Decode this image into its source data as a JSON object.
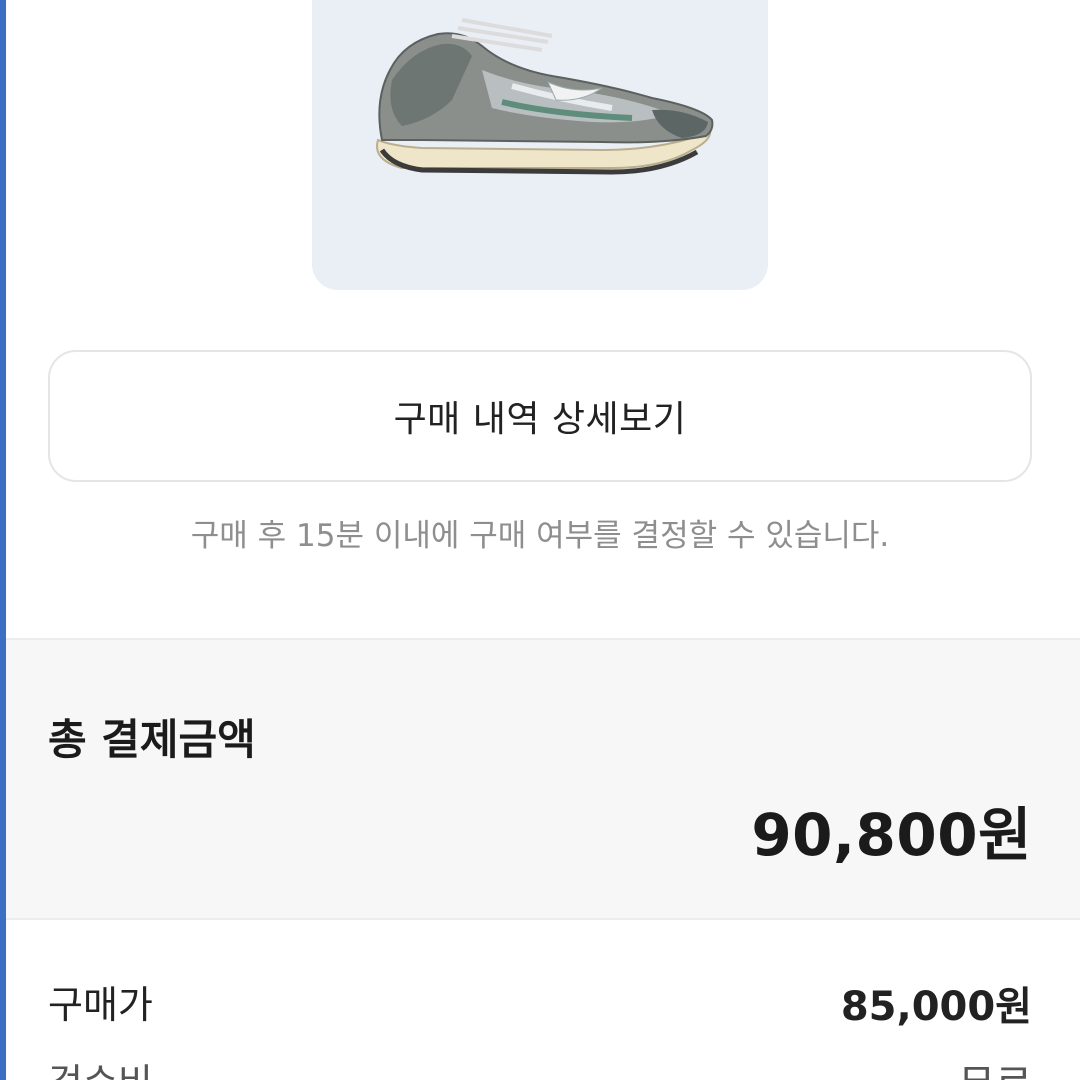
{
  "product": {
    "image_icon": "sneaker-image",
    "card_color": "#e9eff5"
  },
  "detail_button": {
    "label": "구매 내역 상세보기"
  },
  "notice": {
    "text": "구매 후 15분 이내에 구매 여부를 결정할 수 있습니다."
  },
  "total": {
    "label": "총 결제금액",
    "amount": "90,800원"
  },
  "breakdown": [
    {
      "label": "구매가",
      "value": "85,000원"
    },
    {
      "label": "검수비",
      "value": "무료"
    }
  ]
}
